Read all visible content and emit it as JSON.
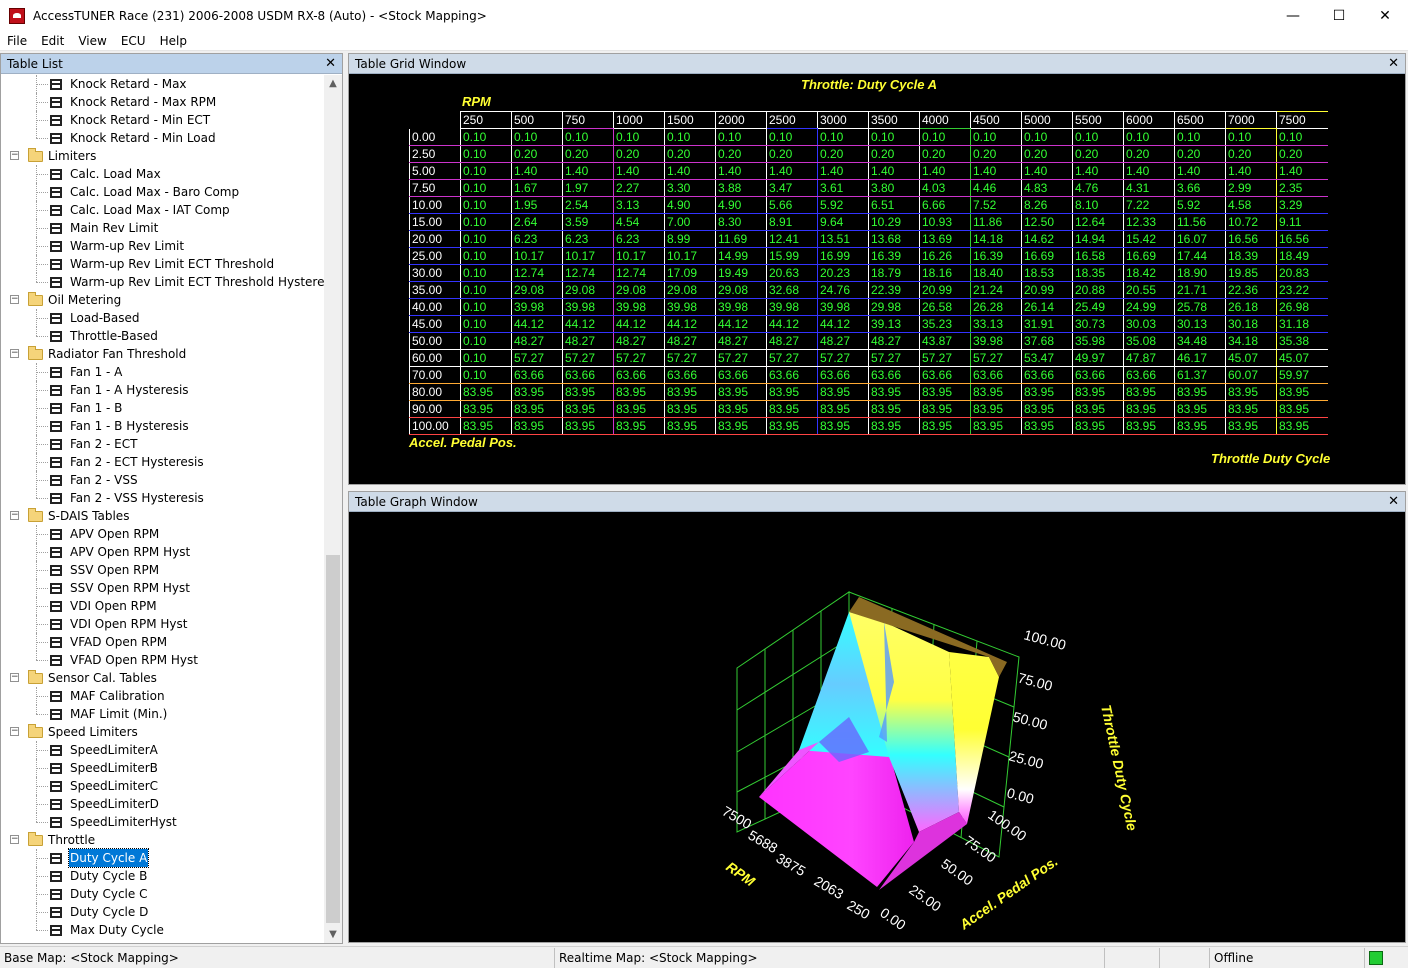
{
  "window": {
    "title": "AccessTUNER Race (231) 2006-2008 USDM RX-8 (Auto) - <Stock Mapping>",
    "minimize": "—",
    "maximize": "☐",
    "close": "✕"
  },
  "menu": [
    "File",
    "Edit",
    "View",
    "ECU",
    "Help"
  ],
  "table_list": {
    "title": "Table List",
    "close": "✕",
    "rows": [
      {
        "type": "leaf",
        "label": "Knock Retard - Max"
      },
      {
        "type": "leaf",
        "label": "Knock Retard - Max RPM"
      },
      {
        "type": "leaf",
        "label": "Knock Retard - Min ECT"
      },
      {
        "type": "leaf",
        "label": "Knock Retard - Min Load"
      },
      {
        "type": "group",
        "label": "Limiters"
      },
      {
        "type": "leaf",
        "label": "Calc. Load Max"
      },
      {
        "type": "leaf",
        "label": "Calc. Load Max - Baro Comp"
      },
      {
        "type": "leaf",
        "label": "Calc. Load Max - IAT Comp"
      },
      {
        "type": "leaf",
        "label": "Main Rev Limit"
      },
      {
        "type": "leaf",
        "label": "Warm-up Rev Limit"
      },
      {
        "type": "leaf",
        "label": "Warm-up Rev Limit ECT Threshold"
      },
      {
        "type": "leaf",
        "label": "Warm-up Rev Limit ECT Threshold Hysteresis"
      },
      {
        "type": "group",
        "label": "Oil Metering"
      },
      {
        "type": "leaf",
        "label": "Load-Based"
      },
      {
        "type": "leaf",
        "label": "Throttle-Based"
      },
      {
        "type": "group",
        "label": "Radiator Fan Threshold"
      },
      {
        "type": "leaf",
        "label": "Fan 1 - A"
      },
      {
        "type": "leaf",
        "label": "Fan 1 - A Hysteresis"
      },
      {
        "type": "leaf",
        "label": "Fan 1 - B"
      },
      {
        "type": "leaf",
        "label": "Fan 1 - B Hysteresis"
      },
      {
        "type": "leaf",
        "label": "Fan 2 - ECT"
      },
      {
        "type": "leaf",
        "label": "Fan 2 - ECT Hysteresis"
      },
      {
        "type": "leaf",
        "label": "Fan 2 - VSS"
      },
      {
        "type": "leaf",
        "label": "Fan 2 - VSS Hysteresis"
      },
      {
        "type": "group",
        "label": "S-DAIS Tables"
      },
      {
        "type": "leaf",
        "label": "APV Open RPM"
      },
      {
        "type": "leaf",
        "label": "APV Open RPM Hyst"
      },
      {
        "type": "leaf",
        "label": "SSV Open RPM"
      },
      {
        "type": "leaf",
        "label": "SSV Open RPM Hyst"
      },
      {
        "type": "leaf",
        "label": "VDI Open RPM"
      },
      {
        "type": "leaf",
        "label": "VDI Open RPM Hyst"
      },
      {
        "type": "leaf",
        "label": "VFAD Open RPM"
      },
      {
        "type": "leaf",
        "label": "VFAD Open RPM Hyst"
      },
      {
        "type": "group",
        "label": "Sensor Cal. Tables"
      },
      {
        "type": "leaf",
        "label": "MAF Calibration"
      },
      {
        "type": "leaf",
        "label": "MAF Limit (Min.)"
      },
      {
        "type": "group",
        "label": "Speed Limiters"
      },
      {
        "type": "leaf",
        "label": "SpeedLimiterA"
      },
      {
        "type": "leaf",
        "label": "SpeedLimiterB"
      },
      {
        "type": "leaf",
        "label": "SpeedLimiterC"
      },
      {
        "type": "leaf",
        "label": "SpeedLimiterD"
      },
      {
        "type": "leaf",
        "label": "SpeedLimiterHyst"
      },
      {
        "type": "group",
        "label": "Throttle"
      },
      {
        "type": "leaf",
        "label": "Duty Cycle A",
        "selected": true
      },
      {
        "type": "leaf",
        "label": "Duty Cycle B"
      },
      {
        "type": "leaf",
        "label": "Duty Cycle C"
      },
      {
        "type": "leaf",
        "label": "Duty Cycle D"
      },
      {
        "type": "leaf",
        "label": "Max Duty Cycle"
      }
    ]
  },
  "grid_window": {
    "title": "Table Grid Window",
    "close": "✕",
    "table_title": "Throttle: Duty Cycle A",
    "x_axis_label": "RPM",
    "y_axis_label": "Accel. Pedal Pos.",
    "value_label": "Throttle Duty Cycle",
    "columns": [
      "250",
      "500",
      "750",
      "1000",
      "1500",
      "2000",
      "2500",
      "3000",
      "3500",
      "4000",
      "4500",
      "5000",
      "5500",
      "6000",
      "6500",
      "7000",
      "7500"
    ],
    "rows": [
      {
        "h": "0.00",
        "v": [
          "0.10",
          "0.10",
          "0.10",
          "0.10",
          "0.10",
          "0.10",
          "0.10",
          "0.10",
          "0.10",
          "0.10",
          "0.10",
          "0.10",
          "0.10",
          "0.10",
          "0.10",
          "0.10",
          "0.10"
        ]
      },
      {
        "h": "2.50",
        "v": [
          "0.10",
          "0.20",
          "0.20",
          "0.20",
          "0.20",
          "0.20",
          "0.20",
          "0.20",
          "0.20",
          "0.20",
          "0.20",
          "0.20",
          "0.20",
          "0.20",
          "0.20",
          "0.20",
          "0.20"
        ]
      },
      {
        "h": "5.00",
        "v": [
          "0.10",
          "1.40",
          "1.40",
          "1.40",
          "1.40",
          "1.40",
          "1.40",
          "1.40",
          "1.40",
          "1.40",
          "1.40",
          "1.40",
          "1.40",
          "1.40",
          "1.40",
          "1.40",
          "1.40"
        ]
      },
      {
        "h": "7.50",
        "v": [
          "0.10",
          "1.67",
          "1.97",
          "2.27",
          "3.30",
          "3.88",
          "3.47",
          "3.61",
          "3.80",
          "4.03",
          "4.46",
          "4.83",
          "4.76",
          "4.31",
          "3.66",
          "2.99",
          "2.35"
        ]
      },
      {
        "h": "10.00",
        "v": [
          "0.10",
          "1.95",
          "2.54",
          "3.13",
          "4.90",
          "4.90",
          "5.66",
          "5.92",
          "6.51",
          "6.66",
          "7.52",
          "8.26",
          "8.10",
          "7.22",
          "5.92",
          "4.58",
          "3.29"
        ]
      },
      {
        "h": "15.00",
        "v": [
          "0.10",
          "2.64",
          "3.59",
          "4.54",
          "7.00",
          "8.30",
          "8.91",
          "9.64",
          "10.29",
          "10.93",
          "11.86",
          "12.50",
          "12.64",
          "12.33",
          "11.56",
          "10.72",
          "9.11"
        ]
      },
      {
        "h": "20.00",
        "v": [
          "0.10",
          "6.23",
          "6.23",
          "6.23",
          "8.99",
          "11.69",
          "12.41",
          "13.51",
          "13.68",
          "13.69",
          "14.18",
          "14.62",
          "14.94",
          "15.42",
          "16.07",
          "16.56",
          "16.56"
        ]
      },
      {
        "h": "25.00",
        "v": [
          "0.10",
          "10.17",
          "10.17",
          "10.17",
          "10.17",
          "14.99",
          "15.99",
          "16.99",
          "16.39",
          "16.26",
          "16.39",
          "16.69",
          "16.58",
          "16.69",
          "17.44",
          "18.39",
          "18.49"
        ]
      },
      {
        "h": "30.00",
        "v": [
          "0.10",
          "12.74",
          "12.74",
          "12.74",
          "17.09",
          "19.49",
          "20.63",
          "20.23",
          "18.79",
          "18.16",
          "18.40",
          "18.53",
          "18.35",
          "18.42",
          "18.90",
          "19.85",
          "20.83"
        ]
      },
      {
        "h": "35.00",
        "v": [
          "0.10",
          "29.08",
          "29.08",
          "29.08",
          "29.08",
          "29.08",
          "32.68",
          "24.76",
          "22.39",
          "20.99",
          "21.24",
          "20.99",
          "20.88",
          "20.55",
          "21.71",
          "22.36",
          "23.22"
        ]
      },
      {
        "h": "40.00",
        "v": [
          "0.10",
          "39.98",
          "39.98",
          "39.98",
          "39.98",
          "39.98",
          "39.98",
          "39.98",
          "29.98",
          "26.58",
          "26.28",
          "26.14",
          "25.49",
          "24.99",
          "25.78",
          "26.18",
          "26.98"
        ]
      },
      {
        "h": "45.00",
        "v": [
          "0.10",
          "44.12",
          "44.12",
          "44.12",
          "44.12",
          "44.12",
          "44.12",
          "44.12",
          "39.13",
          "35.23",
          "33.13",
          "31.91",
          "30.73",
          "30.03",
          "30.13",
          "30.18",
          "31.18"
        ]
      },
      {
        "h": "50.00",
        "v": [
          "0.10",
          "48.27",
          "48.27",
          "48.27",
          "48.27",
          "48.27",
          "48.27",
          "48.27",
          "48.27",
          "43.87",
          "39.98",
          "37.68",
          "35.98",
          "35.08",
          "34.48",
          "34.18",
          "35.38"
        ]
      },
      {
        "h": "60.00",
        "v": [
          "0.10",
          "57.27",
          "57.27",
          "57.27",
          "57.27",
          "57.27",
          "57.27",
          "57.27",
          "57.27",
          "57.27",
          "57.27",
          "53.47",
          "49.97",
          "47.87",
          "46.17",
          "45.07",
          "45.07"
        ]
      },
      {
        "h": "70.00",
        "v": [
          "0.10",
          "63.66",
          "63.66",
          "63.66",
          "63.66",
          "63.66",
          "63.66",
          "63.66",
          "63.66",
          "63.66",
          "63.66",
          "63.66",
          "63.66",
          "63.66",
          "61.37",
          "60.07",
          "59.97"
        ]
      },
      {
        "h": "80.00",
        "v": [
          "83.95",
          "83.95",
          "83.95",
          "83.95",
          "83.95",
          "83.95",
          "83.95",
          "83.95",
          "83.95",
          "83.95",
          "83.95",
          "83.95",
          "83.95",
          "83.95",
          "83.95",
          "83.95",
          "83.95"
        ]
      },
      {
        "h": "90.00",
        "v": [
          "83.95",
          "83.95",
          "83.95",
          "83.95",
          "83.95",
          "83.95",
          "83.95",
          "83.95",
          "83.95",
          "83.95",
          "83.95",
          "83.95",
          "83.95",
          "83.95",
          "83.95",
          "83.95",
          "83.95"
        ]
      },
      {
        "h": "100.00",
        "v": [
          "83.95",
          "83.95",
          "83.95",
          "83.95",
          "83.95",
          "83.95",
          "83.95",
          "83.95",
          "83.95",
          "83.95",
          "83.95",
          "83.95",
          "83.95",
          "83.95",
          "83.95",
          "83.95",
          "83.95"
        ]
      }
    ]
  },
  "graph_window": {
    "title": "Table Graph Window",
    "close": "✕",
    "z_ticks": [
      "100.00",
      "75.00",
      "50.00",
      "25.00",
      "0.00"
    ],
    "y_ticks": [
      "100.00",
      "75.00",
      "50.00",
      "25.00",
      "0.00"
    ],
    "x_ticks": [
      "7500",
      "5688",
      "3875",
      "2063",
      "250"
    ],
    "x_axis_label": "RPM",
    "y_axis_label": "Accel. Pedal Pos.",
    "z_axis_label": "Throttle Duty Cycle"
  },
  "status": {
    "base_map": "Base Map: <Stock Mapping>",
    "realtime_map": "Realtime Map: <Stock Mapping>",
    "connection": "Offline"
  },
  "colors": {
    "grid_text": "#33ff33",
    "header_text": "#ffffff",
    "title_text": "#ffff33",
    "status_led": "#22cc33"
  }
}
